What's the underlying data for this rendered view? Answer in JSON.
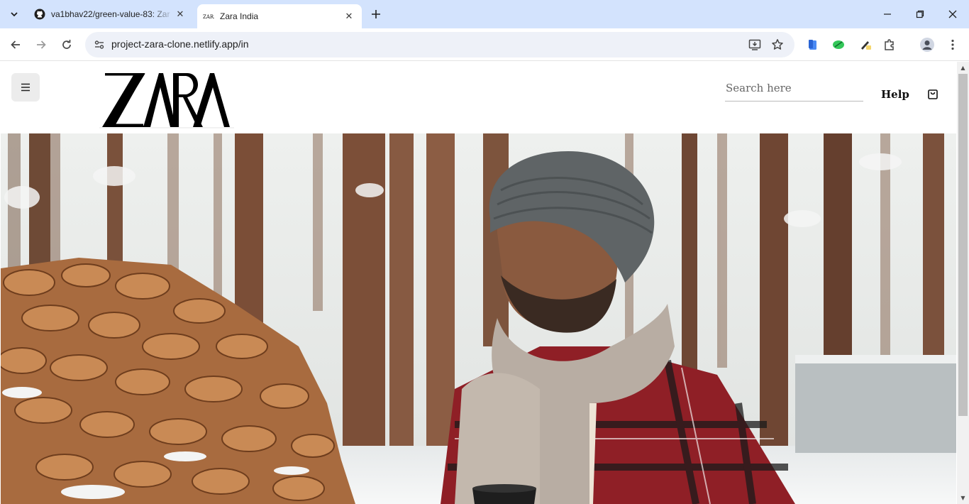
{
  "browser": {
    "tabs": [
      {
        "title": "va1bhav22/green-value-83: Zar",
        "active": false
      },
      {
        "title": "Zara India",
        "active": true
      }
    ],
    "url": "project-zara-clone.netlify.app/in"
  },
  "header": {
    "brand": "ZARA",
    "search_placeholder": "Search here",
    "help_label": "Help"
  },
  "hero": {
    "description": "photo"
  },
  "colors": {
    "tabstrip": "#d3e3fd",
    "omnibox": "#eef1f8",
    "menu_button_bg": "#ececec"
  }
}
